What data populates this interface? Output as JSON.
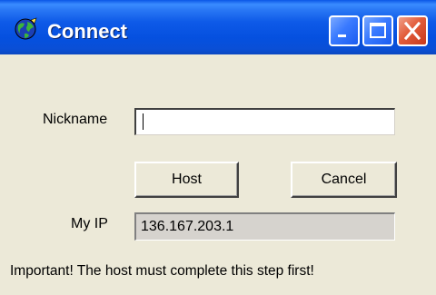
{
  "window": {
    "title": "Connect",
    "icon": "globe-icon",
    "controls": [
      "minimize-icon",
      "maximize-icon",
      "close-icon"
    ]
  },
  "form": {
    "nickname_label": "Nickname",
    "nickname_value": "",
    "host_label": "Host",
    "cancel_label": "Cancel",
    "my_ip_label": "My IP",
    "my_ip_value": "136.167.203.1",
    "notice": "Important! The host must complete this step first!"
  },
  "colors": {
    "titlebar": "#0a56e6",
    "close_button": "#e25c3a",
    "window_background": "#ece9d8"
  }
}
